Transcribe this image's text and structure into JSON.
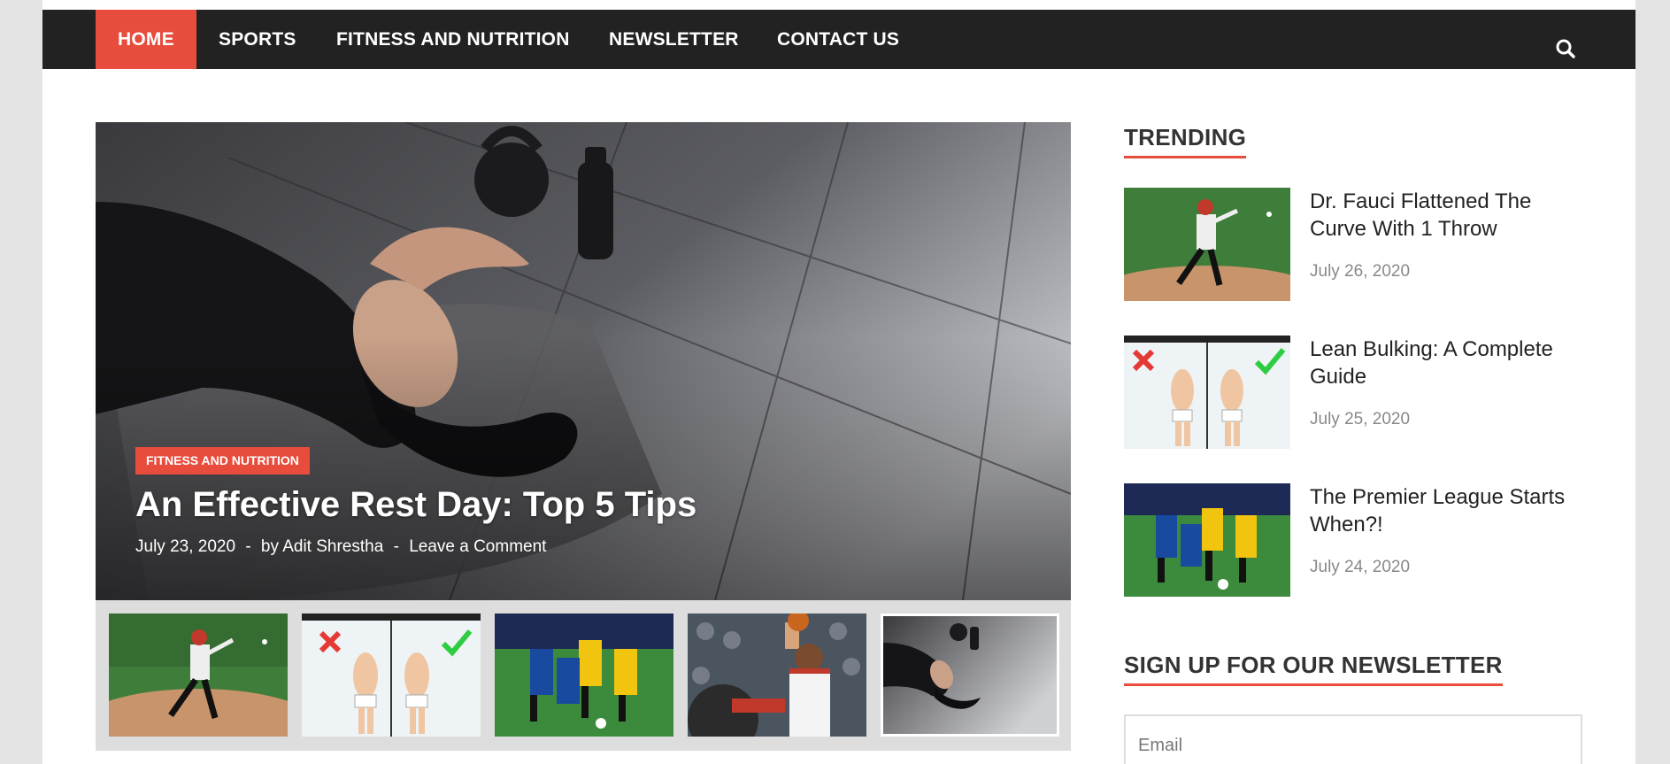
{
  "colors": {
    "accent": "#e74c3c",
    "nav_bg": "#222222",
    "page_bg": "#ffffff",
    "outer_bg": "#e4e4e4"
  },
  "nav": {
    "items": [
      {
        "label": "HOME",
        "active": true
      },
      {
        "label": "SPORTS",
        "active": false
      },
      {
        "label": "FITNESS AND NUTRITION",
        "active": false
      },
      {
        "label": "NEWSLETTER",
        "active": false
      },
      {
        "label": "CONTACT US",
        "active": false
      }
    ],
    "search_icon": "search-icon"
  },
  "hero": {
    "category": "FITNESS AND NUTRITION",
    "title": "An Effective Rest Day: Top 5 Tips",
    "date": "July 23, 2020",
    "separator": "-",
    "author": "by Adit Shrestha",
    "comment_link": "Leave a Comment"
  },
  "slider_thumbs": [
    {
      "subject": "baseball pitcher"
    },
    {
      "subject": "lean bulking chart"
    },
    {
      "subject": "soccer match"
    },
    {
      "subject": "basketball player"
    },
    {
      "subject": "woman resting",
      "selected": true
    }
  ],
  "sidebar": {
    "trending_title": "TRENDING",
    "trending": [
      {
        "title": "Dr. Fauci Flattened The Curve With 1 Throw",
        "date": "July 26, 2020"
      },
      {
        "title": "Lean Bulking: A Complete Guide",
        "date": "July 25, 2020"
      },
      {
        "title": "The Premier League Starts When?!",
        "date": "July 24, 2020"
      }
    ],
    "newsletter_title": "SIGN UP FOR OUR NEWSLETTER",
    "email_placeholder": "Email"
  }
}
